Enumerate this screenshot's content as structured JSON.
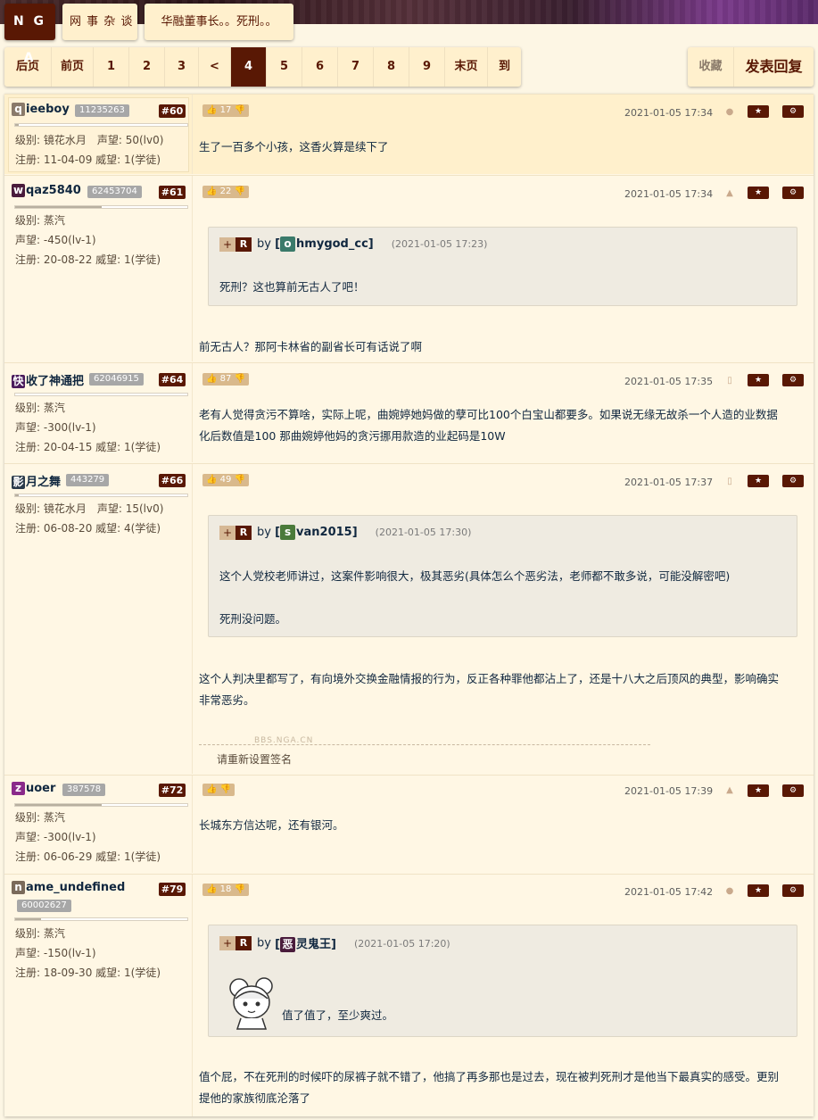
{
  "header": {
    "logo": "N G A",
    "forum": "网 事 杂 谈",
    "thread_title": "华融董事长。。死刑。。"
  },
  "pager": {
    "items": [
      "后页",
      "前页",
      "1",
      "2",
      "3",
      "<",
      "4",
      "5",
      "6",
      "7",
      "8",
      "9",
      "末页",
      "到"
    ],
    "current": "4"
  },
  "actions": {
    "favorite": "收藏",
    "reply": "发表回复"
  },
  "posts": [
    {
      "initial": "q",
      "initial_color": "#8a7a6a",
      "name_rest": "ieeboy",
      "uid": "11235263",
      "floor": "#60",
      "info": [
        "级别: 镜花水月　声望: 50(lv0)",
        "注册: 11-04-09 威望: 1(学徒)"
      ],
      "votes": "17",
      "time": "2021-01-05 17:34",
      "device": "apple",
      "body": [
        "生了一百多个小孩，这香火算是续下了"
      ]
    },
    {
      "initial": "w",
      "initial_color": "#4a1c3c",
      "name_rest": "qaz5840",
      "uid": "62453704",
      "floor": "#61",
      "info": [
        "级别: 蒸汽",
        "声望: -450(lv-1)",
        "注册: 20-08-22 威望: 1(学徒)"
      ],
      "votes": "22",
      "time": "2021-01-05 17:34",
      "device": "android",
      "quote": {
        "initial": "o",
        "initial_color": "#3a7a6a",
        "name_rest": "hmygod_cc]",
        "time": "(2021-01-05 17:23)",
        "text": [
          "死刑？这也算前无古人了吧！"
        ]
      },
      "body": [
        "前无古人？那阿卡林省的副省长可有话说了啊"
      ]
    },
    {
      "initial": "快",
      "initial_color": "#4a1c5c",
      "name_rest": "收了神通把",
      "uid": "62046915",
      "floor": "#64",
      "info": [
        "级别: 蒸汽",
        "声望: -300(lv-1)",
        "注册: 20-04-15 威望: 1(学徒)"
      ],
      "votes": "87",
      "time": "2021-01-05 17:35",
      "device": "mobile",
      "body": [
        "老有人觉得贪污不算啥，实际上呢，曲婉婷她妈做的孽可比100个白宝山都要多。如果说无缘无故杀一个人造的业数据",
        "化后数值是100 那曲婉婷他妈的贪污挪用款造的业起码是10W"
      ]
    },
    {
      "initial": "影",
      "initial_color": "#2a3a4a",
      "name_rest": "月之舞",
      "uid": "443279",
      "floor": "#66",
      "info": [
        "级别: 镜花水月　声望: 15(lv0)",
        "注册: 06-08-20 威望: 4(学徒)"
      ],
      "votes": "49",
      "time": "2021-01-05 17:37",
      "device": "mobile",
      "quote": {
        "initial": "s",
        "initial_color": "#4a7a3a",
        "name_rest": "van2015]",
        "time": "(2021-01-05 17:30)",
        "text": [
          "这个人党校老师讲过，这案件影响很大，极其恶劣(具体怎么个恶劣法，老师都不敢多说，可能没解密吧)",
          "",
          "死刑没问题。"
        ]
      },
      "body": [
        "这个人判决里都写了，有向境外交换金融情报的行为，反正各种罪他都沾上了，还是十八大之后顶风的典型，影响确实",
        "非常恶劣。"
      ],
      "sig_site": "BBS.NGA.CN",
      "signature": "请重新设置签名"
    },
    {
      "initial": "z",
      "initial_color": "#8a2a8a",
      "name_rest": "uoer",
      "uid": "387578",
      "floor": "#72",
      "info": [
        "级别: 蒸汽",
        "声望: -300(lv-1)",
        "注册: 06-06-29 威望: 1(学徒)"
      ],
      "votes": "",
      "time": "2021-01-05 17:39",
      "device": "android",
      "body": [
        "长城东方信达呢，还有银河。"
      ]
    },
    {
      "initial": "n",
      "initial_color": "#7a6a5a",
      "name_rest": "ame_undefined",
      "uid": "60002627",
      "floor": "#79",
      "info": [
        "级别: 蒸汽",
        "声望: -150(lv-1)",
        "注册: 18-09-30 威望: 1(学徒)"
      ],
      "votes": "18",
      "time": "2021-01-05 17:42",
      "device": "apple",
      "quote": {
        "initial": "恶",
        "initial_color": "#4a1c3c",
        "name_rest": "灵鬼王]",
        "time": "(2021-01-05 17:20)",
        "text": [
          "值了值了，至少爽过。"
        ]
      },
      "body": [
        "值个屁，不在死刑的时候吓的尿裤子就不错了，他搞了再多那也是过去，现在被判死刑才是他当下最真实的感受。更别",
        "提他的家族彻底沦落了"
      ]
    }
  ],
  "labels": {
    "by": "by",
    "plus": "+",
    "r": "R",
    "thumb": "👍",
    "dislike": "👎",
    "star": "★",
    "gear": "⚙"
  }
}
